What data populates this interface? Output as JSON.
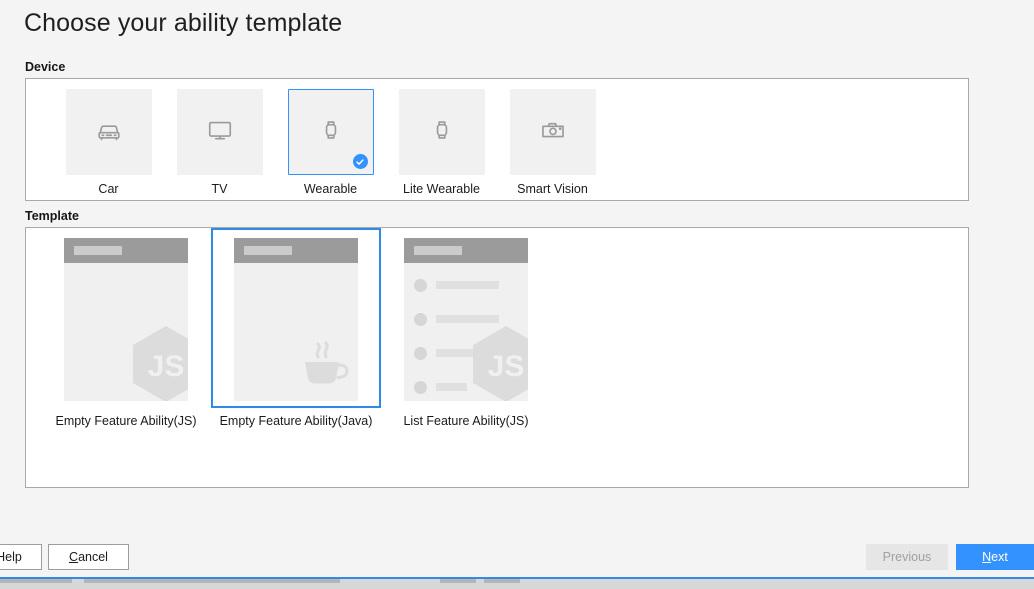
{
  "page": {
    "title": "Choose your ability template",
    "background_color": "#f4f4f4",
    "accent_color": "#3392ff"
  },
  "device_section": {
    "label": "Device",
    "selected_index": 2,
    "items": [
      {
        "label": "Car",
        "icon": "car-icon",
        "selected": false
      },
      {
        "label": "TV",
        "icon": "tv-icon",
        "selected": false
      },
      {
        "label": "Wearable",
        "icon": "watch-icon",
        "selected": true
      },
      {
        "label": "Lite Wearable",
        "icon": "watch-icon",
        "selected": false
      },
      {
        "label": "Smart Vision",
        "icon": "camera-icon",
        "selected": false
      }
    ]
  },
  "template_section": {
    "label": "Template",
    "selected_index": 1,
    "items": [
      {
        "label": "Empty Feature Ability(JS)",
        "preview": "empty-js",
        "logo": "js-hexagon-logo",
        "selected": false
      },
      {
        "label": "Empty Feature Ability(Java)",
        "preview": "empty-java",
        "logo": "java-cup-logo",
        "selected": true
      },
      {
        "label": "List Feature Ability(JS)",
        "preview": "list-js",
        "logo": "js-hexagon-logo",
        "selected": false
      }
    ]
  },
  "footer": {
    "help_label": "Help",
    "cancel_label": "Cancel",
    "previous_label": "Previous",
    "next_label": "Next",
    "previous_enabled": false,
    "next_enabled": true
  }
}
